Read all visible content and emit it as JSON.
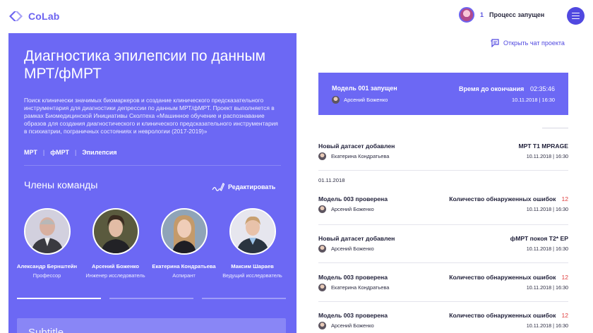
{
  "header": {
    "logo_text": "CoLab",
    "process_count": "1",
    "process_label": "Процесс запущен"
  },
  "project": {
    "title": "Диагностика эпилепсии по данным МРТ/фМРТ",
    "description": "Поиск клинически значимых биомаркеров и создание клинического предсказательного инструментария для диагностики депрессии по данным МРТ/фМРТ. Проект выполняется в рамках Биомедицинской Инициативы Сколтеха «Машинное обучение и распознавание образов для создания диагностического и клинического предсказательного инструментария в психиатрии, пограничных состояниях и неврологии (2017-2019)»",
    "tags": [
      "МРТ",
      "фМРТ",
      "Эпилепсия"
    ],
    "team_title": "Члены команды",
    "edit_label": "Редактировать",
    "members": [
      {
        "name": "Александр Бернштейн",
        "role": "Профессор"
      },
      {
        "name": "Арсений Боженко",
        "role": "Инженер исследователь"
      },
      {
        "name": "Екатерина Кондратьева",
        "role": "Аспирант"
      },
      {
        "name": "Максим Шараев",
        "role": "Ведущий исследователь"
      }
    ],
    "subtitle": "Subtitle"
  },
  "chat": {
    "label": "Открыть чат проекта"
  },
  "running": {
    "model_label": "Модель 001 запущен",
    "user": "Арсений Боженко",
    "time_label": "Время до окончания",
    "time_value": "02:35:46",
    "date": "10.11.2018 | 16:30"
  },
  "feed": {
    "items": [
      {
        "event": "Новый датасет добавлен",
        "user": "Екатерина Кондратьева",
        "detail": "МРТ T1 MPRAGE",
        "count": "",
        "date": "10.11.2018 | 16:30"
      },
      {
        "event": "Модель  003 проверена",
        "user": "Арсений Боженко",
        "detail": "Количество обнаруженных ошибок",
        "count": "12",
        "date": "10.11.2018 | 16:30"
      },
      {
        "event": "Новый датасет добавлен",
        "user": "Арсений Боженко",
        "detail": "фМРТ покоя T2* EP",
        "count": "",
        "date": "10.11.2018 | 16:30"
      },
      {
        "event": "Модель  003 проверена",
        "user": "Екатерина Кондратьева",
        "detail": "Количество обнаруженных ошибок",
        "count": "12",
        "date": "10.11.2018 | 16:30"
      },
      {
        "event": "Модель  003 проверена",
        "user": "Арсений Боженко",
        "detail": "Количество обнаруженных ошибок",
        "count": "12",
        "date": "10.11.2018 | 16:30"
      }
    ],
    "date_heading": "01.11.2018"
  },
  "colors": {
    "accent": "#6c68f4",
    "accent_dark": "#5048e0",
    "error": "#e04040"
  },
  "icons": {
    "logo": "colab-logo-icon",
    "menu": "hamburger-menu-icon",
    "chat": "chat-icon",
    "edit": "edit-pen-icon"
  }
}
